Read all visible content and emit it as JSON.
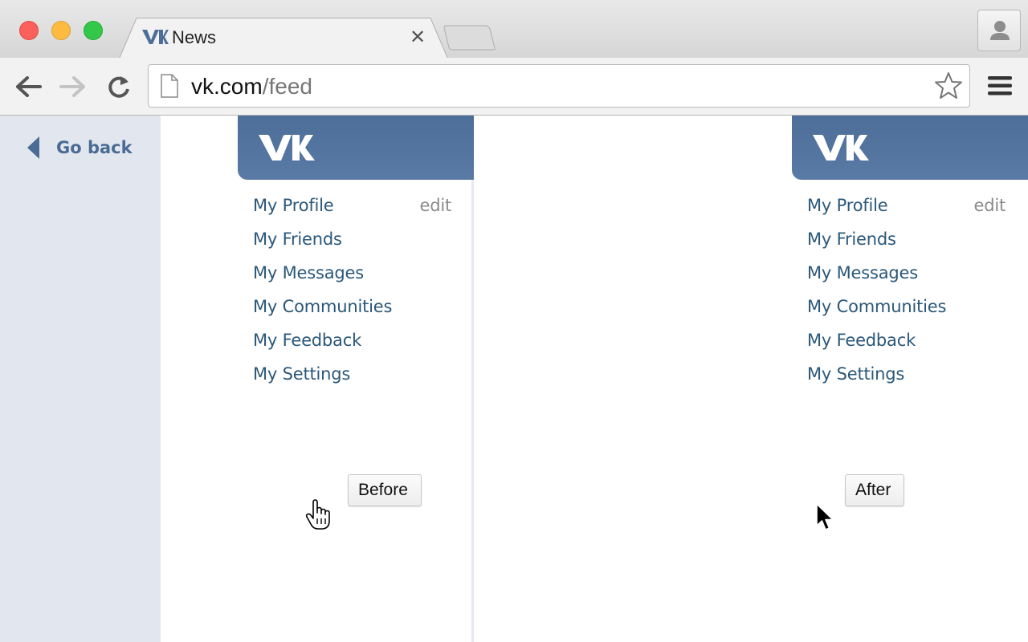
{
  "browser": {
    "tab": {
      "title": "News",
      "favicon": "vk-logo-icon",
      "close_glyph": "✕"
    },
    "address_bar": {
      "domain": "vk.com",
      "path": "/feed"
    },
    "toolbar": {
      "back_icon": "back-arrow-icon",
      "forward_icon": "forward-arrow-icon",
      "reload_icon": "reload-icon",
      "bookmark_icon": "star-icon",
      "menu_icon": "hamburger-menu-icon",
      "profile_icon": "person-icon"
    }
  },
  "left_panel": {
    "go_back_label": "Go back"
  },
  "before": {
    "caption": "Before",
    "menu": [
      {
        "label": "My Profile",
        "extra": "edit"
      },
      {
        "label": "My Friends"
      },
      {
        "label": "My Messages"
      },
      {
        "label": "My Communities"
      },
      {
        "label": "My Feedback"
      },
      {
        "label": "My Settings"
      }
    ],
    "cursor": "hand-pointer-icon"
  },
  "after": {
    "caption": "After",
    "menu": [
      {
        "label": "My Profile",
        "extra": "edit"
      },
      {
        "label": "My Friends"
      },
      {
        "label": "My Messages"
      },
      {
        "label": "My Communities"
      },
      {
        "label": "My Feedback"
      },
      {
        "label": "My Settings"
      }
    ],
    "cursor": "arrow-pointer-icon"
  },
  "colors": {
    "vk_blue": "#5077a5",
    "link": "#2b587a",
    "left_panel_bg": "#e2e7ef",
    "go_back": "#4a6b93"
  }
}
